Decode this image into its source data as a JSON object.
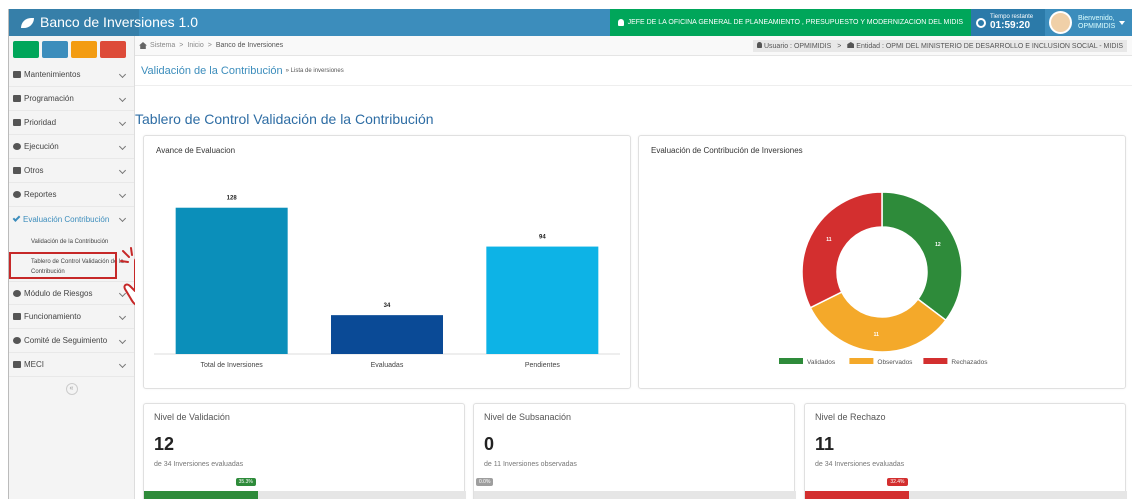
{
  "app": {
    "title": "Banco de Inversiones 1.0",
    "brand_color": "#3c8dbc"
  },
  "header": {
    "cargo": "JEFE DE LA OFICINA GENERAL DE PLANEAMIENTO , PRESUPUESTO Y MODERNIZACION DEL MIDIS",
    "timer_label": "Tiempo restante",
    "timer_value": "01:59:20",
    "welcome": "Bienvenido,",
    "username": "OPMIMIDIS"
  },
  "sidebar": {
    "button_colors": [
      "#00a65a",
      "#3c8dbc",
      "#f39c12",
      "#dd4b39"
    ],
    "items": [
      {
        "label": "Mantenimientos"
      },
      {
        "label": "Programación"
      },
      {
        "label": "Prioridad"
      },
      {
        "label": "Ejecución"
      },
      {
        "label": "Otros"
      },
      {
        "label": "Reportes"
      },
      {
        "label": "Evaluación Contribución"
      },
      {
        "label": "Módulo de Riesgos"
      },
      {
        "label": "Funcionamiento"
      },
      {
        "label": "Comité de Seguimiento"
      },
      {
        "label": "MECI"
      }
    ],
    "subitems": [
      {
        "label": "Validación de la Contribución"
      },
      {
        "label": "Tablero de Control Validación de la Contribución"
      }
    ],
    "collapse_glyph": "«"
  },
  "breadcrumb": {
    "items": [
      "Sistema",
      "Inicio",
      "Banco de Inversiones"
    ],
    "separator": ">",
    "usuario": "Usuario : OPMIMIDIS",
    "entidad": "Entidad : OPMI DEL MINISTERIO DE DESARROLLO E INCLUSION SOCIAL - MIDIS"
  },
  "subheader": {
    "title": "Validación de la Contribución",
    "small": "» Lista de inversiones"
  },
  "page": {
    "title": "Tablero de Control Validación de la Contribución"
  },
  "chart_data": [
    {
      "type": "bar",
      "title": "Avance de Evaluacion",
      "categories": [
        "Total de Inversiones",
        "Evaluadas",
        "Pendientes"
      ],
      "values": [
        128,
        34,
        94
      ],
      "colors": [
        "#0b8fba",
        "#0a4a96",
        "#0db3e6"
      ],
      "ylim": [
        0,
        140
      ],
      "grid": false
    },
    {
      "type": "pie",
      "title": "Evaluación de Contribución de Inversiones",
      "labels": [
        "Validados",
        "Observados",
        "Rechazados"
      ],
      "values": [
        12,
        11,
        11
      ],
      "colors": [
        "#2e8b3a",
        "#f4a92a",
        "#d32f2f"
      ],
      "donut": true,
      "legend": "bottom"
    }
  ],
  "kpis": [
    {
      "title": "Nivel de Validación",
      "value": "12",
      "desc": "de 34 Inversiones evaluadas",
      "percent_label": "35.3%",
      "percent": 35.3,
      "color": "#2e8b3a"
    },
    {
      "title": "Nivel de Subsanación",
      "value": "0",
      "desc": "de 11 Inversiones observadas",
      "percent_label": "0.0%",
      "percent": 0,
      "color": "#9e9e9e"
    },
    {
      "title": "Nivel de Rechazo",
      "value": "11",
      "desc": "de 34 Inversiones evaluadas",
      "percent_label": "32.4%",
      "percent": 32.4,
      "color": "#d32f2f"
    }
  ]
}
